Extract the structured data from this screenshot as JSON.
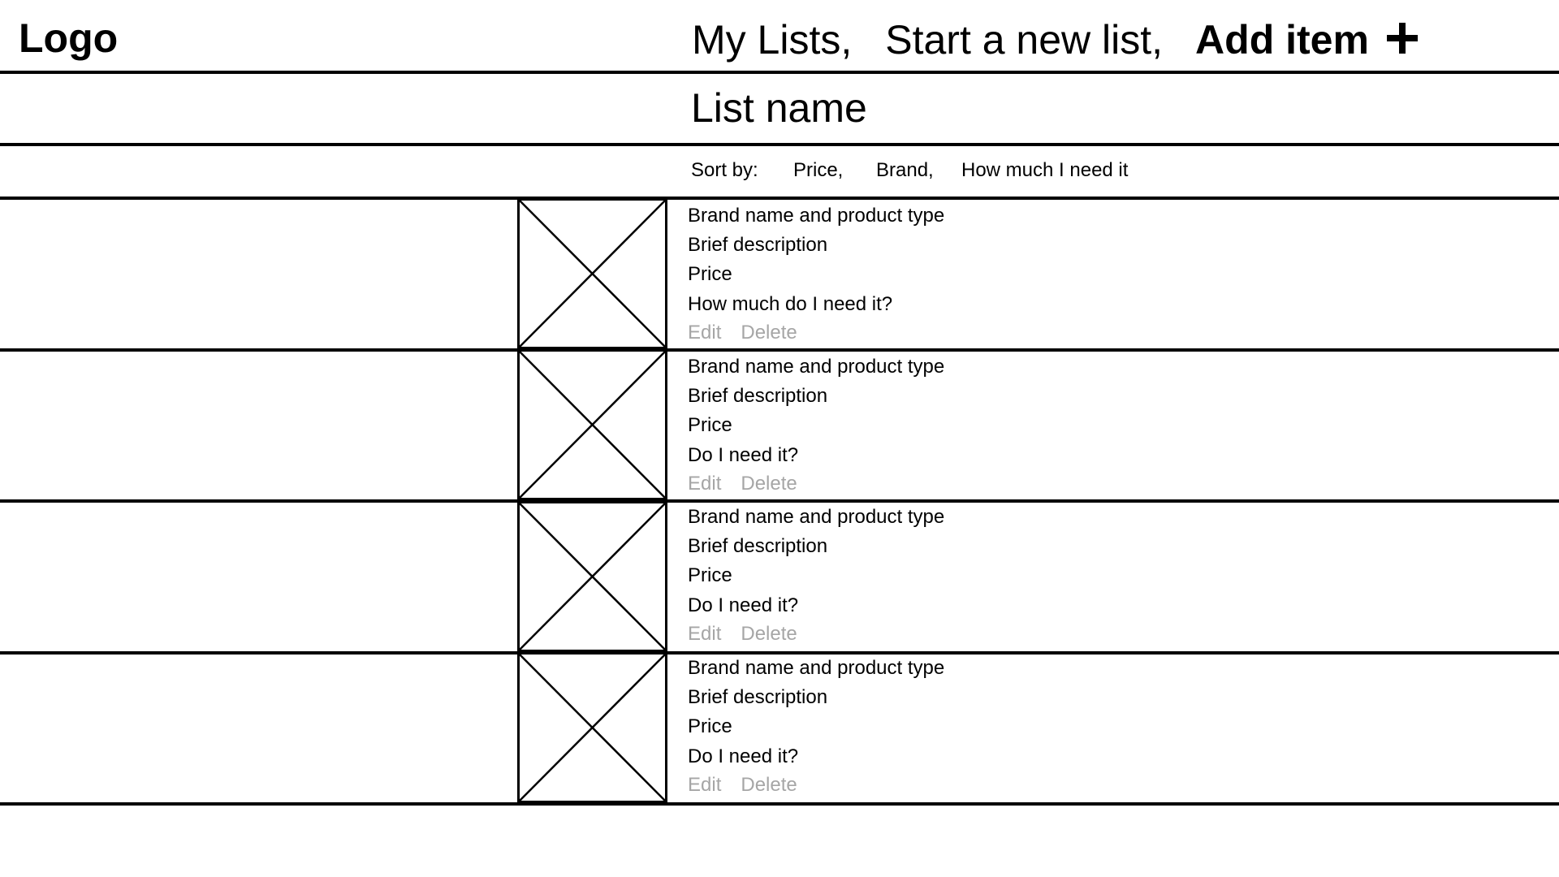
{
  "header": {
    "logo": "Logo",
    "nav": {
      "my_lists": "My Lists,",
      "start_new_list": "Start a new list,",
      "add_item": "Add item"
    }
  },
  "list": {
    "title": "List name"
  },
  "sort": {
    "label": "Sort by:",
    "options": [
      "Price,",
      "Brand,",
      "How much I need it"
    ]
  },
  "items": [
    {
      "title": "Brand name and product type",
      "description": "Brief description",
      "price": "Price",
      "need": "How much do I need it?",
      "edit": "Edit",
      "delete": "Delete"
    },
    {
      "title": "Brand name and product type",
      "description": "Brief description",
      "price": "Price",
      "need": "Do I need it?",
      "edit": "Edit",
      "delete": "Delete"
    },
    {
      "title": "Brand name and product type",
      "description": "Brief description",
      "price": "Price",
      "need": "Do I need it?",
      "edit": "Edit",
      "delete": "Delete"
    },
    {
      "title": "Brand name and product type",
      "description": "Brief description",
      "price": "Price",
      "need": "Do I need it?",
      "edit": "Edit",
      "delete": "Delete"
    }
  ],
  "colors": {
    "line": "#000000",
    "muted_action": "#a6a6a6",
    "background": "#ffffff"
  },
  "icons": {
    "add": "plus-icon",
    "image_placeholder": "image-placeholder-icon"
  }
}
